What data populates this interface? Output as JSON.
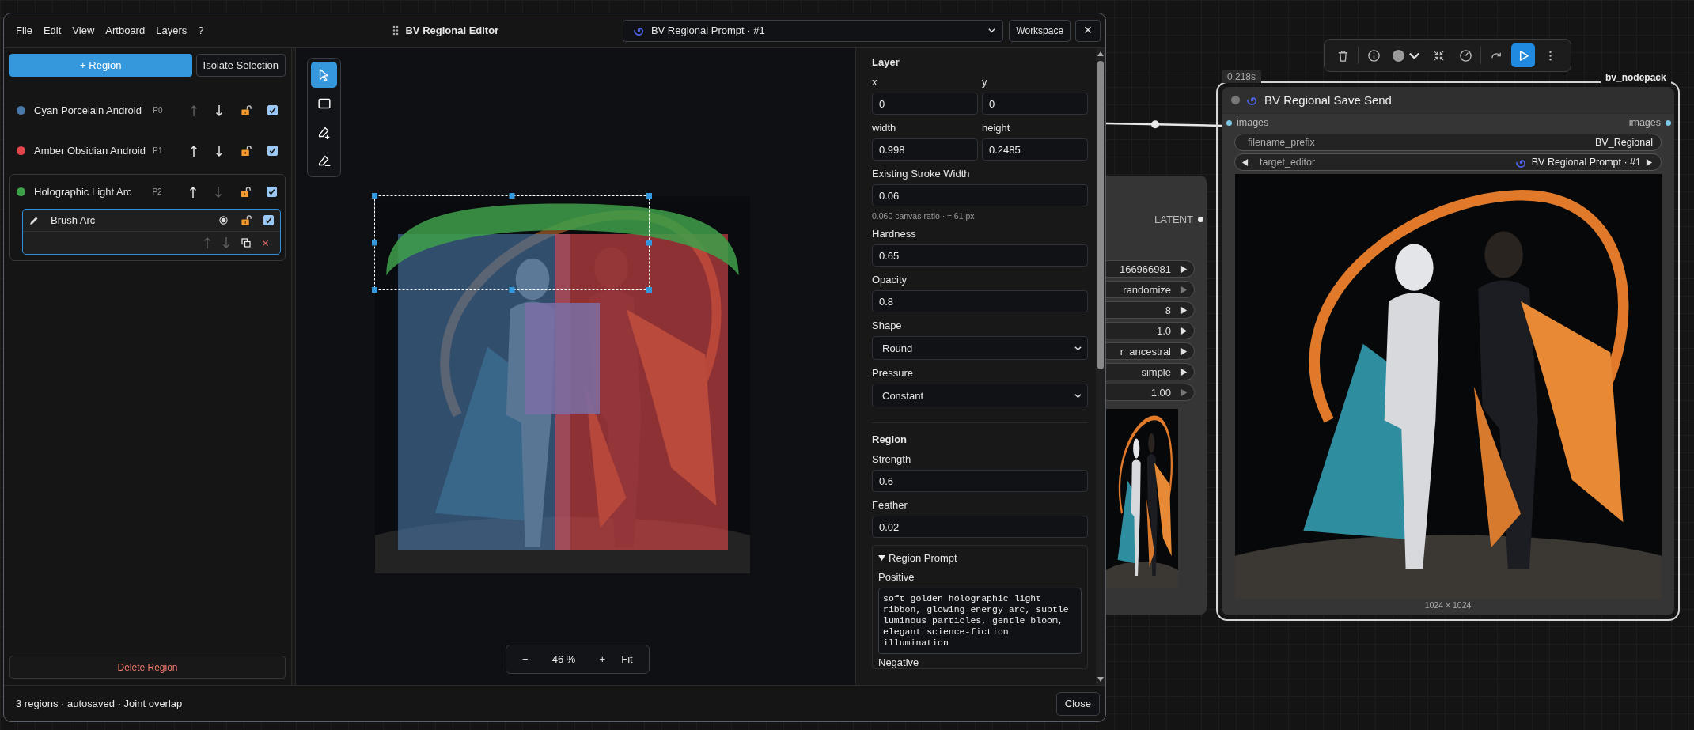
{
  "menu": [
    "File",
    "Edit",
    "View",
    "Artboard",
    "Layers",
    "?"
  ],
  "title": "BV Regional Editor",
  "editor_select": "BV Regional Prompt · #1",
  "workspace_button": "Workspace",
  "close_glyph": "×",
  "add_button": "+ Region",
  "isolate_button": "Isolate Selection",
  "regions": [
    {
      "name": "Cyan Porcelain Android",
      "color": "#4a78a8",
      "priority": "P0",
      "up_disabled": true,
      "down_disabled": false,
      "checked": true
    },
    {
      "name": "Amber Obsidian Android",
      "color": "#e0484c",
      "priority": "P1",
      "up_disabled": false,
      "down_disabled": false,
      "checked": true
    },
    {
      "name": "Holographic Light Arc",
      "color": "#3fa04a",
      "priority": "P2",
      "up_disabled": false,
      "down_disabled": true,
      "checked": true,
      "children": [
        {
          "kind": "brush",
          "name": "Brush Arc",
          "selected": true,
          "checked": true,
          "up_disabled": true,
          "down_disabled": true
        }
      ]
    }
  ],
  "delete_button": "Delete Region",
  "tools": [
    {
      "kind": "select",
      "selected": true
    },
    {
      "kind": "rect",
      "selected": false
    },
    {
      "kind": "brush_add",
      "selected": false
    },
    {
      "kind": "brush_erase",
      "selected": false
    }
  ],
  "zoom": {
    "minus": "−",
    "value": "46 %",
    "plus": "+",
    "fit": "Fit"
  },
  "layer_panel": {
    "heading": "Layer",
    "pairs": [
      {
        "label": "x",
        "value": "0"
      },
      {
        "label": "y",
        "value": "0"
      },
      {
        "label": "width",
        "value": "0.998"
      },
      {
        "label": "height",
        "value": "0.2485"
      }
    ],
    "fields": [
      {
        "kind": "input",
        "label": "Existing Stroke Width",
        "value": "0.06",
        "hint": "0.060 canvas ratio · ≈ 61 px"
      },
      {
        "kind": "input",
        "label": "Hardness",
        "value": "0.65"
      },
      {
        "kind": "input",
        "label": "Opacity",
        "value": "0.8"
      },
      {
        "kind": "select",
        "label": "Shape",
        "value": "Round"
      },
      {
        "kind": "select",
        "label": "Pressure",
        "value": "Constant"
      }
    ]
  },
  "region_panel": {
    "heading": "Region",
    "fields": [
      {
        "kind": "input",
        "label": "Strength",
        "value": "0.6"
      },
      {
        "kind": "input",
        "label": "Feather",
        "value": "0.02"
      }
    ],
    "prompt": {
      "title": "Region Prompt",
      "expanded": true,
      "positive_label": "Positive",
      "positive": "soft golden holographic light ribbon, glowing energy arc, subtle luminous particles, gentle bloom, elegant science-fiction illumination",
      "negative_label": "Negative"
    }
  },
  "status": "3 regions · autosaved · Joint overlap",
  "close_button": "Close",
  "left_node": {
    "output": "LATENT",
    "widgets": [
      "166966981",
      "randomize",
      "8",
      "1.0",
      "r_ancestral",
      "simple",
      "1.00"
    ]
  },
  "node": {
    "time": "0.218s",
    "pack": "bv_nodepack",
    "title": "BV Regional Save Send",
    "input": "images",
    "output": "images",
    "widgets": [
      {
        "kind": "text",
        "label": "filename_prefix",
        "value": "BV_Regional"
      },
      {
        "kind": "combo",
        "label": "target_editor",
        "value": "BV Regional Prompt · #1"
      }
    ],
    "image_size": "1024 × 1024"
  }
}
